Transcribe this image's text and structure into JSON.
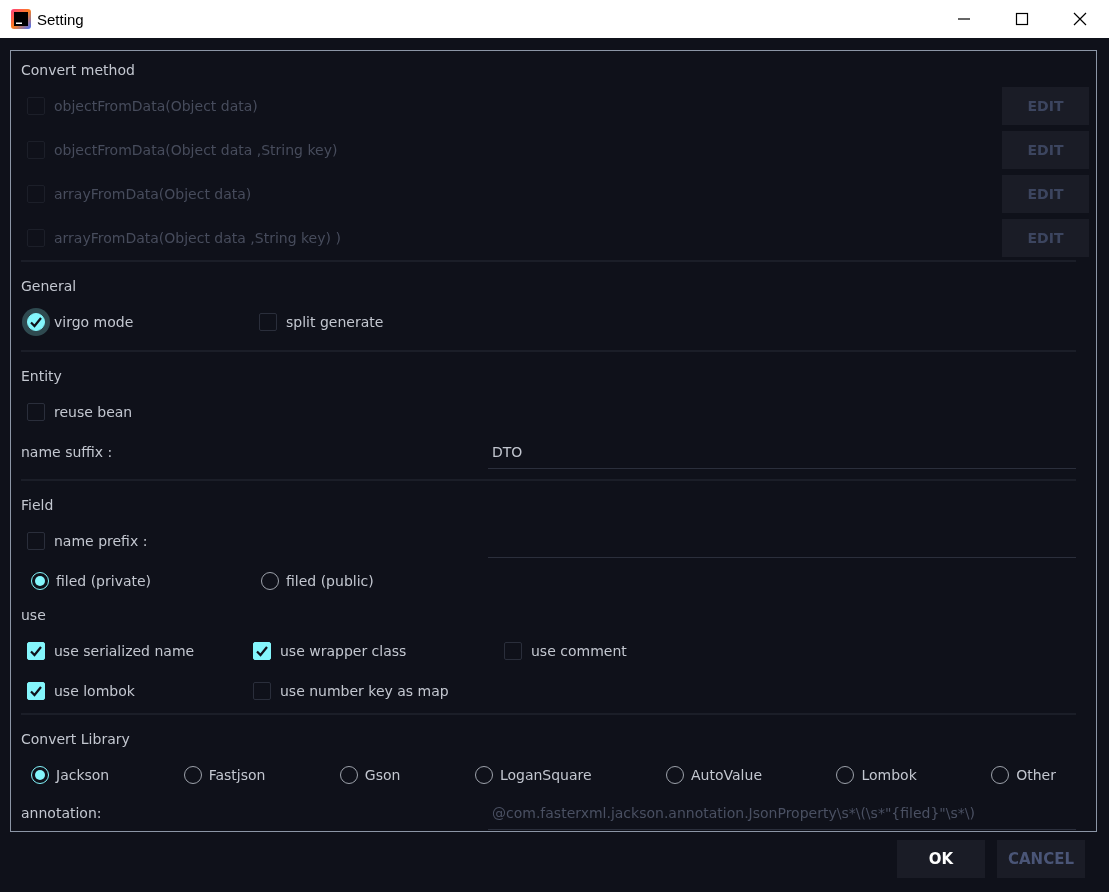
{
  "window": {
    "title": "Setting"
  },
  "convert_method": {
    "title": "Convert method",
    "methods": [
      {
        "label": "objectFromData(Object data)",
        "checked": false,
        "disabled": true,
        "button": "EDIT"
      },
      {
        "label": "objectFromData(Object data ,String key)",
        "checked": false,
        "disabled": true,
        "button": "EDIT"
      },
      {
        "label": "arrayFromData(Object data)",
        "checked": false,
        "disabled": true,
        "button": "EDIT"
      },
      {
        "label": "arrayFromData(Object data ,String key) )",
        "checked": false,
        "disabled": true,
        "button": "EDIT"
      }
    ]
  },
  "general": {
    "title": "General",
    "options": [
      {
        "label": "virgo mode",
        "checked": true,
        "focused": true
      },
      {
        "label": "split generate",
        "checked": false,
        "focused": false
      }
    ]
  },
  "entity": {
    "title": "Entity",
    "reuse_bean": {
      "label": "reuse bean",
      "checked": false
    },
    "name_suffix": {
      "label": "name suffix :",
      "value": "DTO"
    }
  },
  "field": {
    "title": "Field",
    "name_prefix": {
      "label": "name prefix :",
      "checked": false
    },
    "visibility": [
      {
        "label": "filed (private)",
        "selected": true
      },
      {
        "label": "filed (public)",
        "selected": false
      }
    ]
  },
  "use": {
    "title": "use",
    "options": [
      {
        "label": "use serialized name",
        "checked": true
      },
      {
        "label": "use wrapper class",
        "checked": true
      },
      {
        "label": "use comment",
        "checked": false
      },
      {
        "label": "use lombok",
        "checked": true
      },
      {
        "label": "use number key as map",
        "checked": false
      }
    ]
  },
  "convert_library": {
    "title": "Convert Library",
    "options": [
      {
        "label": "Jackson",
        "selected": true
      },
      {
        "label": "Fastjson",
        "selected": false
      },
      {
        "label": "Gson",
        "selected": false
      },
      {
        "label": "LoganSquare",
        "selected": false
      },
      {
        "label": "AutoValue",
        "selected": false
      },
      {
        "label": "Lombok",
        "selected": false
      },
      {
        "label": "Other",
        "selected": false
      }
    ],
    "annotation": {
      "label": "annotation:",
      "placeholder": "@com.fasterxml.jackson.annotation.JsonProperty\\s*\\(\\s*\"{filed}\"\\s*\\)"
    }
  },
  "buttons": [
    {
      "label": "OK",
      "disabled": false
    },
    {
      "label": "CANCEL",
      "disabled": true
    }
  ]
}
